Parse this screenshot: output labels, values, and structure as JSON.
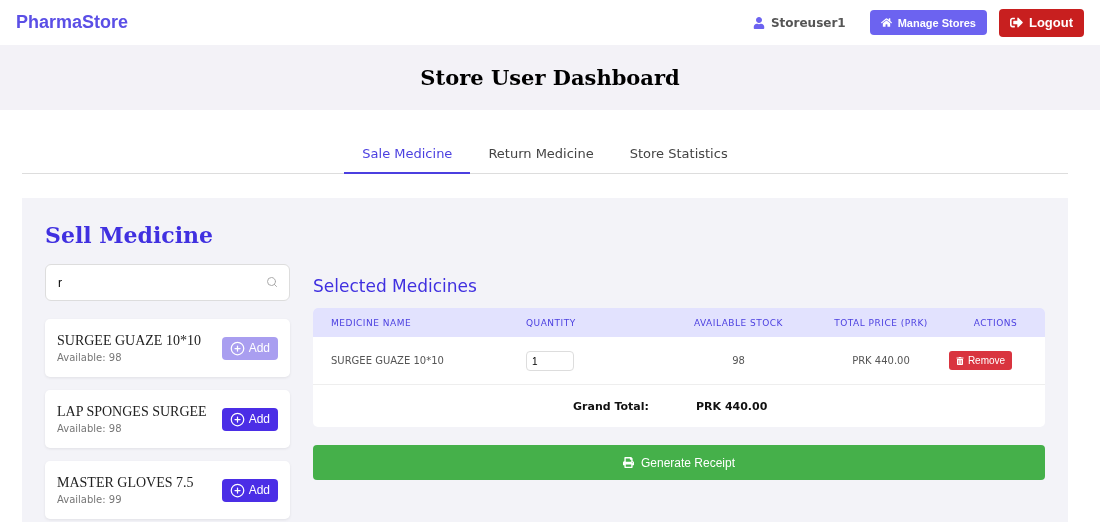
{
  "brand": "PharmaStore",
  "user": {
    "name": "Storeuser1"
  },
  "nav_buttons": [
    {
      "label": "Manage Stores",
      "kind": "manage"
    },
    {
      "label": "Logout",
      "kind": "logout"
    }
  ],
  "title": "Store User Dashboard",
  "tabs": [
    {
      "label": "Sale Medicine",
      "selected": true
    },
    {
      "label": "Return Medicine",
      "selected": false
    },
    {
      "label": "Store Statistics",
      "selected": false
    }
  ],
  "sell": {
    "heading": "Sell Medicine",
    "search": {
      "value": "r"
    },
    "medicines": [
      {
        "name": "SURGEE GUAZE 10*10",
        "available": "Available: 98",
        "button": "Add",
        "disabled": true
      },
      {
        "name": "LAP SPONGES SURGEE",
        "available": "Available: 98",
        "button": "Add",
        "disabled": false
      },
      {
        "name": "MASTER GLOVES 7.5",
        "available": "Available: 99",
        "button": "Add",
        "disabled": false
      }
    ]
  },
  "selected": {
    "heading": "Selected Medicines",
    "columns": [
      "MEDICINE NAME",
      "QUANTITY",
      "AVAILABLE STOCK",
      "TOTAL PRICE (PRK)",
      "ACTIONS"
    ],
    "rows": [
      {
        "name": "SURGEE GUAZE 10*10",
        "quantity": "1",
        "stock": "98",
        "price": "PRK 440.00",
        "action": "Remove"
      }
    ],
    "grand_total_label": "Grand Total:",
    "grand_total": "PRK 440.00",
    "generate_button": "Generate Receipt"
  }
}
